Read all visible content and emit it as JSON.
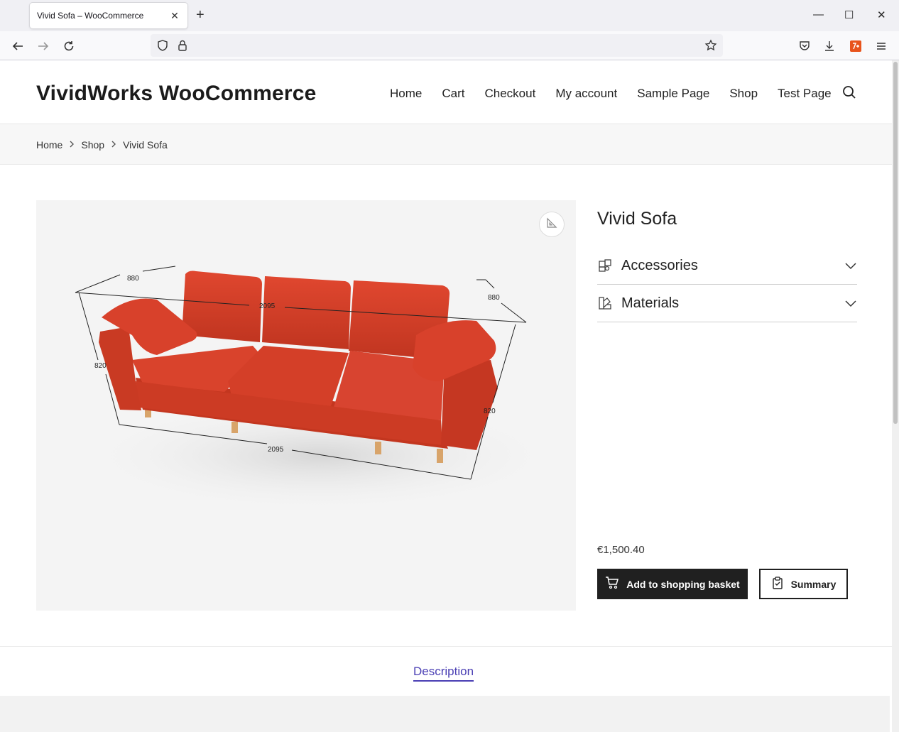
{
  "browser": {
    "tab_title": "Vivid Sofa – WooCommerce",
    "tab_close": "✕",
    "new_tab": "+",
    "win_min": "—",
    "win_max": "☐",
    "win_close": "✕"
  },
  "site": {
    "title": "VividWorks WooCommerce",
    "menu": [
      "Home",
      "Cart",
      "Checkout",
      "My account",
      "Sample Page",
      "Shop",
      "Test Page"
    ]
  },
  "breadcrumb": [
    "Home",
    "Shop",
    "Vivid Sofa"
  ],
  "product": {
    "title": "Vivid Sofa",
    "accordions": [
      "Accessories",
      "Materials"
    ],
    "price": "€1,500.40",
    "add_button": "Add to shopping basket",
    "summary_button": "Summary",
    "sofa_color": "#d8402a",
    "dimensions": {
      "depth_left": "880",
      "depth_right": "880",
      "width_top": "2095",
      "width_bottom": "2095",
      "height_left": "820",
      "height_right": "820"
    }
  },
  "tabs": {
    "description": "Description"
  }
}
